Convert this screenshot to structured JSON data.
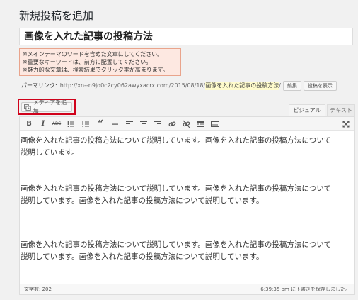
{
  "page": {
    "title": "新規投稿を追加"
  },
  "post": {
    "title": "画像を入れた記事の投稿方法"
  },
  "hint": {
    "lines": [
      "※メインテーマのワードを含めた文章にしてください。",
      "※重要なキーワードは、前方に配置してください。",
      "※魅力的な文章は、検索結果でクリック率が高まります。"
    ]
  },
  "permalink": {
    "label": "パーマリンク:",
    "base": "http://xn--n9jo0c2cy062awyxacrx.com/2015/08/18/",
    "slug": "画像を入れた記事の投稿方法",
    "trail": "/",
    "edit_label": "編集",
    "view_label": "投稿を表示"
  },
  "media": {
    "add_label": "メディアを追加"
  },
  "editor_tabs": {
    "visual": "ビジュアル",
    "text": "テキスト"
  },
  "toolbar": {
    "bold": "B",
    "italic": "I",
    "strike": "ABC",
    "quote": "“",
    "fullscreen": "⤡"
  },
  "content": {
    "para1": "画像を入れた記事の投稿方法について説明しています。画像を入れた記事の投稿方法について説明しています。",
    "para2": "画像を入れた記事の投稿方法について説明しています。画像を入れた記事の投稿方法について説明しています。画像を入れた記事の投稿方法について説明しています。",
    "para3": "画像を入れた記事の投稿方法について説明しています。画像を入れた記事の投稿方法について説明しています。画像を入れた記事の投稿方法について説明しています。"
  },
  "status": {
    "word_count": "文字数: 202",
    "saved": "6:39:35 pm に下書きを保存しました。"
  }
}
